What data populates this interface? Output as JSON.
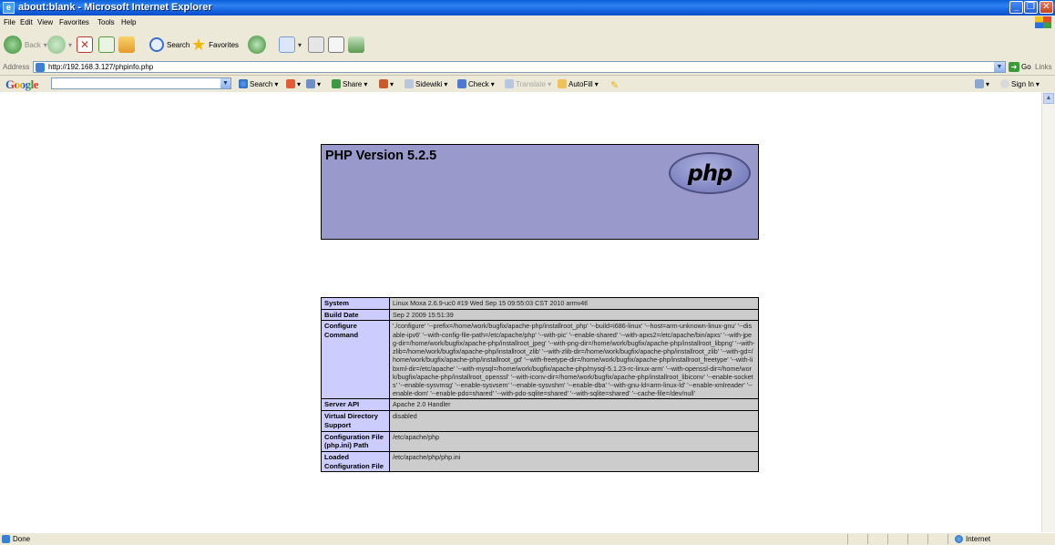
{
  "window": {
    "title": "about:blank - Microsoft Internet Explorer"
  },
  "menu": [
    "File",
    "Edit",
    "View",
    "Favorites",
    "Tools",
    "Help"
  ],
  "toolbar": {
    "back": "Back",
    "search": "Search",
    "favorites": "Favorites"
  },
  "address": {
    "label": "Address",
    "url": "http://192.168.3.127/phpinfo.php",
    "go": "Go",
    "links": "Links"
  },
  "googlebar": {
    "logo": "Google",
    "search": "Search",
    "share": "Share",
    "sidewiki": "Sidewiki",
    "check": "Check",
    "translate": "Translate",
    "autofill": "AutoFill",
    "signin": "Sign In"
  },
  "php": {
    "version_title": "PHP Version 5.2.5",
    "logo_text": "php",
    "rows": [
      {
        "key": "System",
        "value": "Linux Moxa 2.6.9-uc0 #19 Wed Sep 15 09:55:03 CST 2010 armv4tl"
      },
      {
        "key": "Build Date",
        "value": "Sep 2 2009 15:51:39"
      },
      {
        "key": "Configure Command",
        "value": "'./configure' '--prefix=/home/work/bugfix/apache-php/installroot_php' '--build=i686-linux' '--host=arm-unknown-linux-gnu' '--disable-ipv6' '--with-config-file-path=/etc/apache/php' '--with-pic' '--enable-shared' '--with-apxs2=/etc/apache/bin/apxs' '--with-jpeg-dir=/home/work/bugfix/apache-php/installroot_jpeg' '--with-png-dir=/home/work/bugfix/apache-php/installroot_libpng' '--with-zlib=/home/work/bugfix/apache-php/installroot_zlib' '--with-zlib-dir=/home/work/bugfix/apache-php/installroot_zlib' '--with-gd=/home/work/bugfix/apache-php/installroot_gd' '--with-freetype-dir=/home/work/bugfix/apache-php/installroot_freetype' '--with-libxml-dir=/etc/apache' '--with-mysql=/home/work/bugfix/apache-php/mysql-5.1.23-rc-linux-arm' '--with-openssl-dir=/home/work/bugfix/apache-php/installroot_openssl' '--with-iconv-dir=/home/work/bugfix/apache-php/installroot_libiconv' '--enable-sockets' '--enable-sysvmsg' '--enable-sysvsem' '--enable-sysvshm' '--enable-dba' '--with-gnu-ld=arm-linux-ld' '--enable-xmlreader' '--enable-dom' '--enable-pdo=shared' '--with-pdo-sqlite=shared' '--with-sqlite=shared' '--cache-file=/dev/null'"
      },
      {
        "key": "Server API",
        "value": "Apache 2.0 Handler"
      },
      {
        "key": "Virtual Directory Support",
        "value": "disabled"
      },
      {
        "key": "Configuration File (php.ini) Path",
        "value": "/etc/apache/php"
      },
      {
        "key": "Loaded Configuration File",
        "value": "/etc/apache/php/php.ini"
      }
    ]
  },
  "status": {
    "left": "Done",
    "zone": "Internet"
  },
  "colors": {
    "php_header": "#9999cc",
    "php_key": "#ccccff",
    "php_value": "#cccccc",
    "titlebar": "#0a5fd9"
  }
}
